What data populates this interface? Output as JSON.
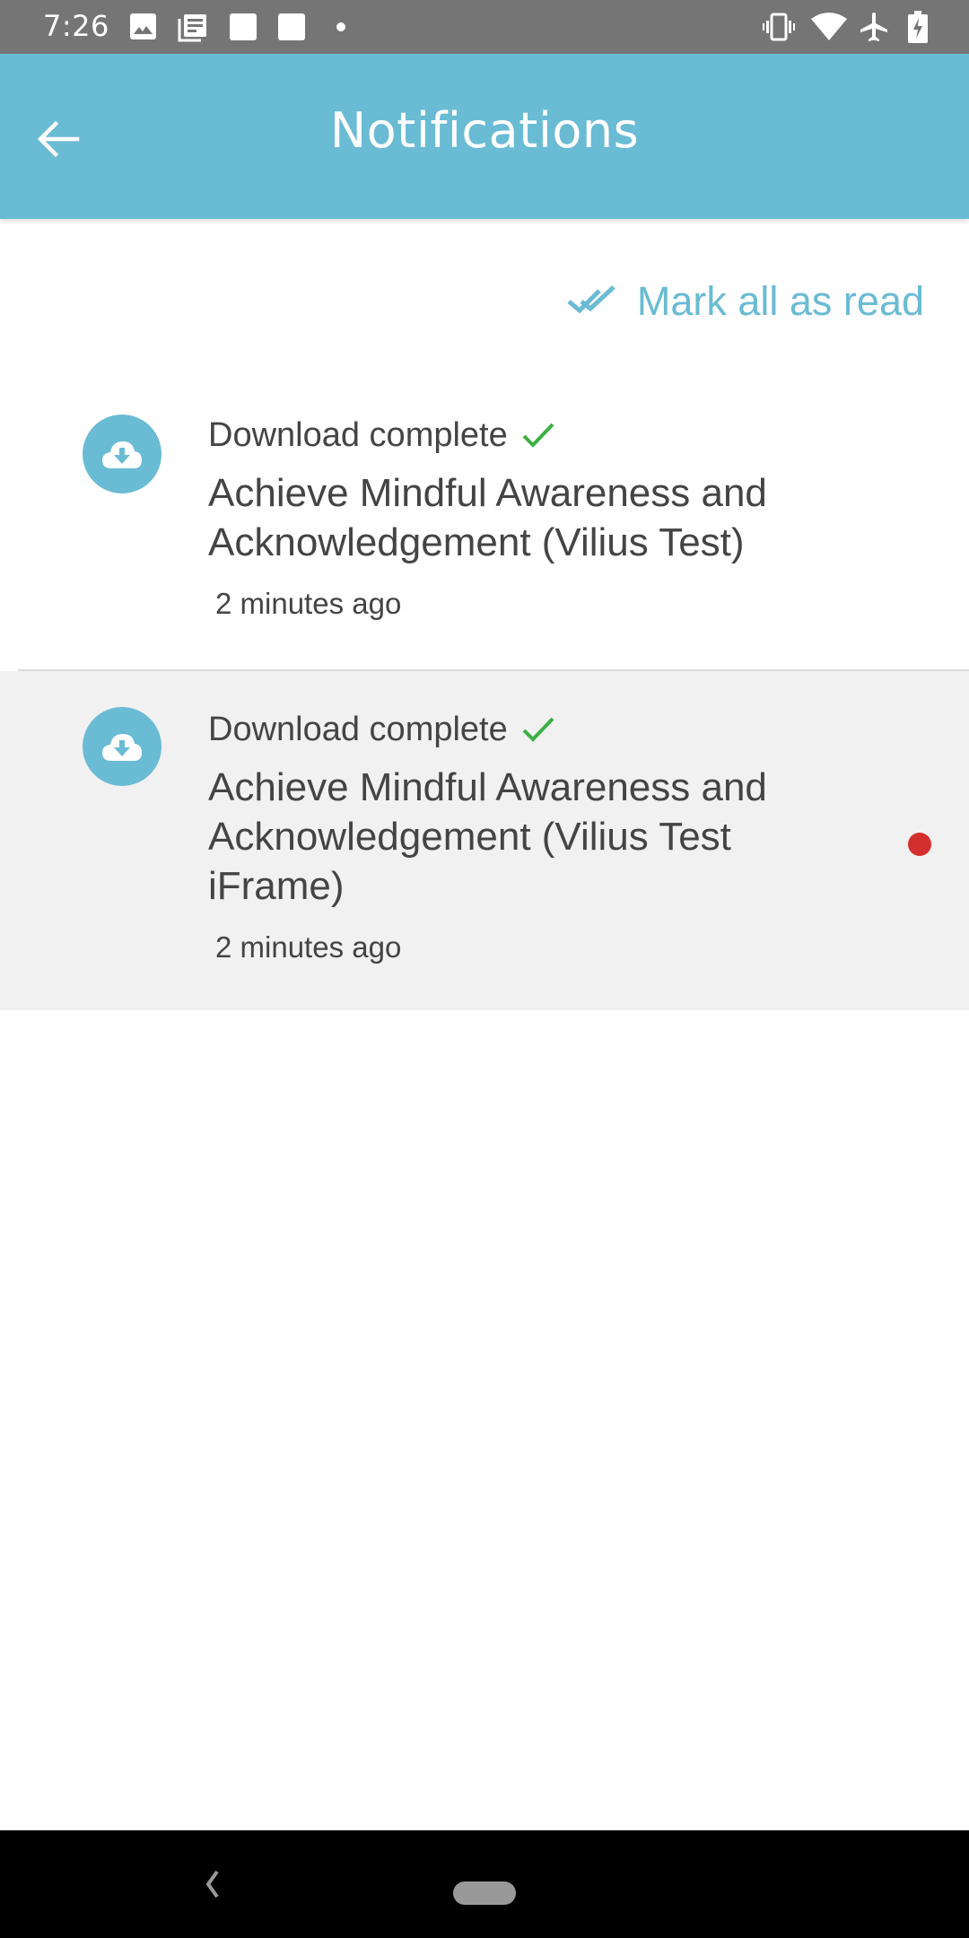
{
  "status_bar": {
    "time": "7:26",
    "left_icons": [
      "image-icon",
      "news-icon",
      "square-icon",
      "square-icon",
      "dot-icon"
    ],
    "right_icons": [
      "vibrate-icon",
      "wifi-icon",
      "airplane-icon",
      "battery-charging-icon"
    ]
  },
  "app_bar": {
    "title": "Notifications",
    "back_icon": "arrow-left-icon"
  },
  "actions": {
    "mark_all_read_label": "Mark all as read",
    "mark_all_read_icon": "double-check-icon"
  },
  "notifications": [
    {
      "icon": "cloud-download-icon",
      "heading": "Download complete",
      "status_icon": "check-icon",
      "title": "Achieve Mindful Awareness and Acknowledgement (Vilius Test)",
      "time": "2 minutes ago",
      "unread": false
    },
    {
      "icon": "cloud-download-icon",
      "heading": "Download complete",
      "status_icon": "check-icon",
      "title": "Achieve Mindful Awareness and Acknowledgement (Vilius Test iFrame)",
      "time": "2 minutes ago",
      "unread": true
    }
  ],
  "colors": {
    "accent": "#6abbd4",
    "success": "#3cb043",
    "unread": "#d32f2f",
    "unread_background": "#f1f1f1",
    "status_bar": "#757575"
  },
  "nav_bar": {
    "back_icon": "nav-back-icon",
    "home_icon": "home-pill-icon"
  }
}
